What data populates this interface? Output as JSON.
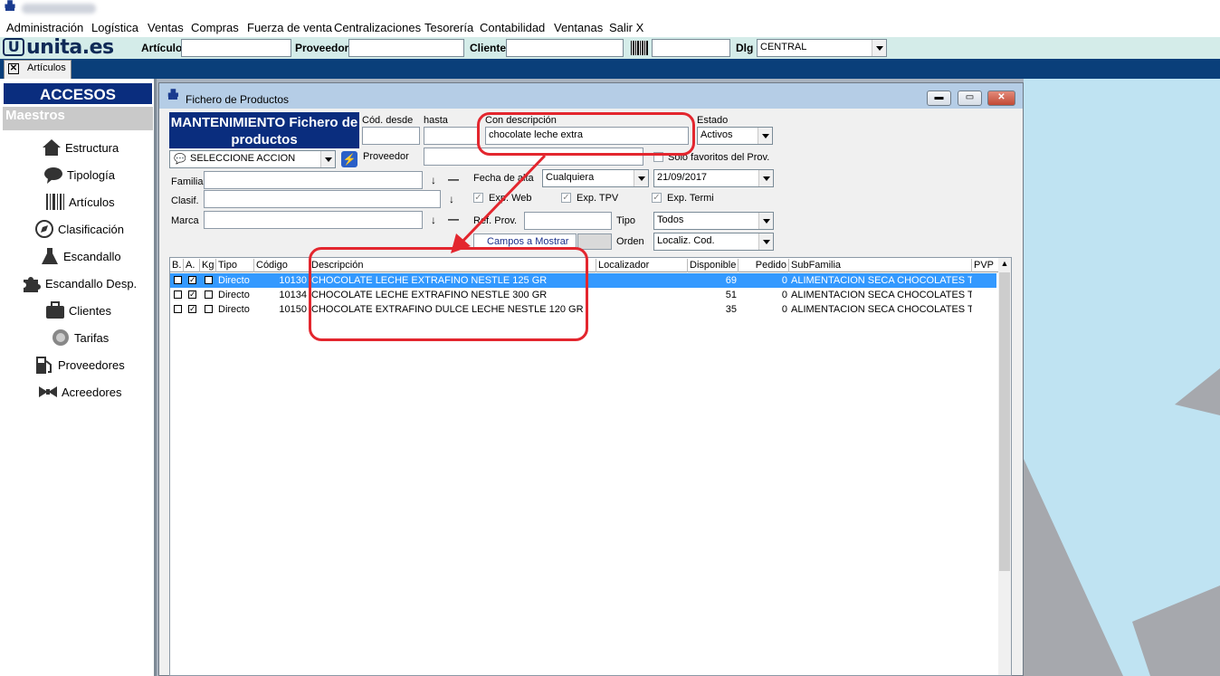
{
  "colors": {
    "accent_dark": "#0a2d7e",
    "selection": "#3399ff",
    "annotation": "#e3262e",
    "desktop": "#bfe3f2"
  },
  "menu": [
    "Administración",
    "Logística",
    "Ventas",
    "Compras",
    "Fuerza de venta",
    "Centralizaciones",
    "Tesorería",
    "Contabilidad",
    "Ventanas",
    "Salir X"
  ],
  "toolbar": {
    "logo": "unita.es",
    "articulo_label": "Artículo",
    "proveedor_label": "Proveedor",
    "cliente_label": "Cliente",
    "dlg_label": "Dlg",
    "dlg_value": "CENTRAL",
    "barcode_icon": "barcode-icon"
  },
  "tab": {
    "label": "Artículos"
  },
  "sidebar": {
    "header": "ACCESOS RAPIDOS",
    "section": "Maestros",
    "items": [
      {
        "label": "Estructura",
        "icon": "house-icon"
      },
      {
        "label": "Tipología",
        "icon": "speech-bubble-icon"
      },
      {
        "label": "Artículos",
        "icon": "barcode-icon"
      },
      {
        "label": "Clasificación",
        "icon": "compass-icon"
      },
      {
        "label": "Escandallo",
        "icon": "flask-icon"
      },
      {
        "label": "Escandallo Desp.",
        "icon": "puzzle-icon"
      },
      {
        "label": "Clientes",
        "icon": "briefcase-icon"
      },
      {
        "label": "Tarifas",
        "icon": "price-tag-icon"
      },
      {
        "label": "Proveedores",
        "icon": "fuel-pump-icon"
      },
      {
        "label": "Acreedores",
        "icon": "bowtie-icon"
      }
    ]
  },
  "window": {
    "title": "Fichero de Productos",
    "panel_title": "MANTENIMIENTO Fichero de productos",
    "cod_desde_label": "Cód. desde",
    "hasta_label": "hasta",
    "con_descripcion_label": "Con descripción",
    "con_descripcion_value": "chocolate leche extra",
    "estado_label": "Estado",
    "estado_value": "Activos",
    "accion_value": "SELECCIONE ACCION",
    "proveedor_label": "Proveedor",
    "solo_favoritos_label": "Sólo favoritos del Prov.",
    "familia_label": "Familia",
    "clasif_label": "Clasif.",
    "marca_label": "Marca",
    "fecha_alta_label": "Fecha de alta",
    "fecha_alta_mode": "Cualquiera",
    "fecha_alta_value": "21/09/2017",
    "exp_web_label": "Exp. Web",
    "exp_tpv_label": "Exp. TPV",
    "exp_termi_label": "Exp. Termi",
    "ref_prov_label": "Ref. Prov.",
    "tipo_label": "Tipo",
    "tipo_value": "Todos",
    "campos_label": "Campos a Mostrar",
    "orden_label": "Orden",
    "orden_value": "Localiz. Cod."
  },
  "grid": {
    "headers": [
      "B.",
      "A.",
      "Kg",
      "Tipo",
      "Código",
      "Descripción",
      "Localizador",
      "Disponible",
      "Pedido",
      "SubFamilia",
      "PVP"
    ],
    "rows": [
      {
        "b": false,
        "a": true,
        "kg": false,
        "tipo": "Directo",
        "codigo": "10130",
        "descripcion": "CHOCOLATE LECHE EXTRAFINO NESTLE 125 GR",
        "localizador": "",
        "disponible": "69",
        "pedido": "0",
        "subfamilia": "ALIMENTACION SECA CHOCOLATES TA",
        "selected": true
      },
      {
        "b": false,
        "a": true,
        "kg": false,
        "tipo": "Directo",
        "codigo": "10134",
        "descripcion": "CHOCOLATE LECHE EXTRAFINO NESTLE 300 GR",
        "localizador": "",
        "disponible": "51",
        "pedido": "0",
        "subfamilia": "ALIMENTACION SECA CHOCOLATES TA",
        "selected": false
      },
      {
        "b": false,
        "a": true,
        "kg": false,
        "tipo": "Directo",
        "codigo": "10150",
        "descripcion": "CHOCOLATE EXTRAFINO DULCE LECHE NESTLE 120 GR",
        "localizador": "",
        "disponible": "35",
        "pedido": "0",
        "subfamilia": "ALIMENTACION SECA CHOCOLATES TA",
        "selected": false
      }
    ]
  }
}
